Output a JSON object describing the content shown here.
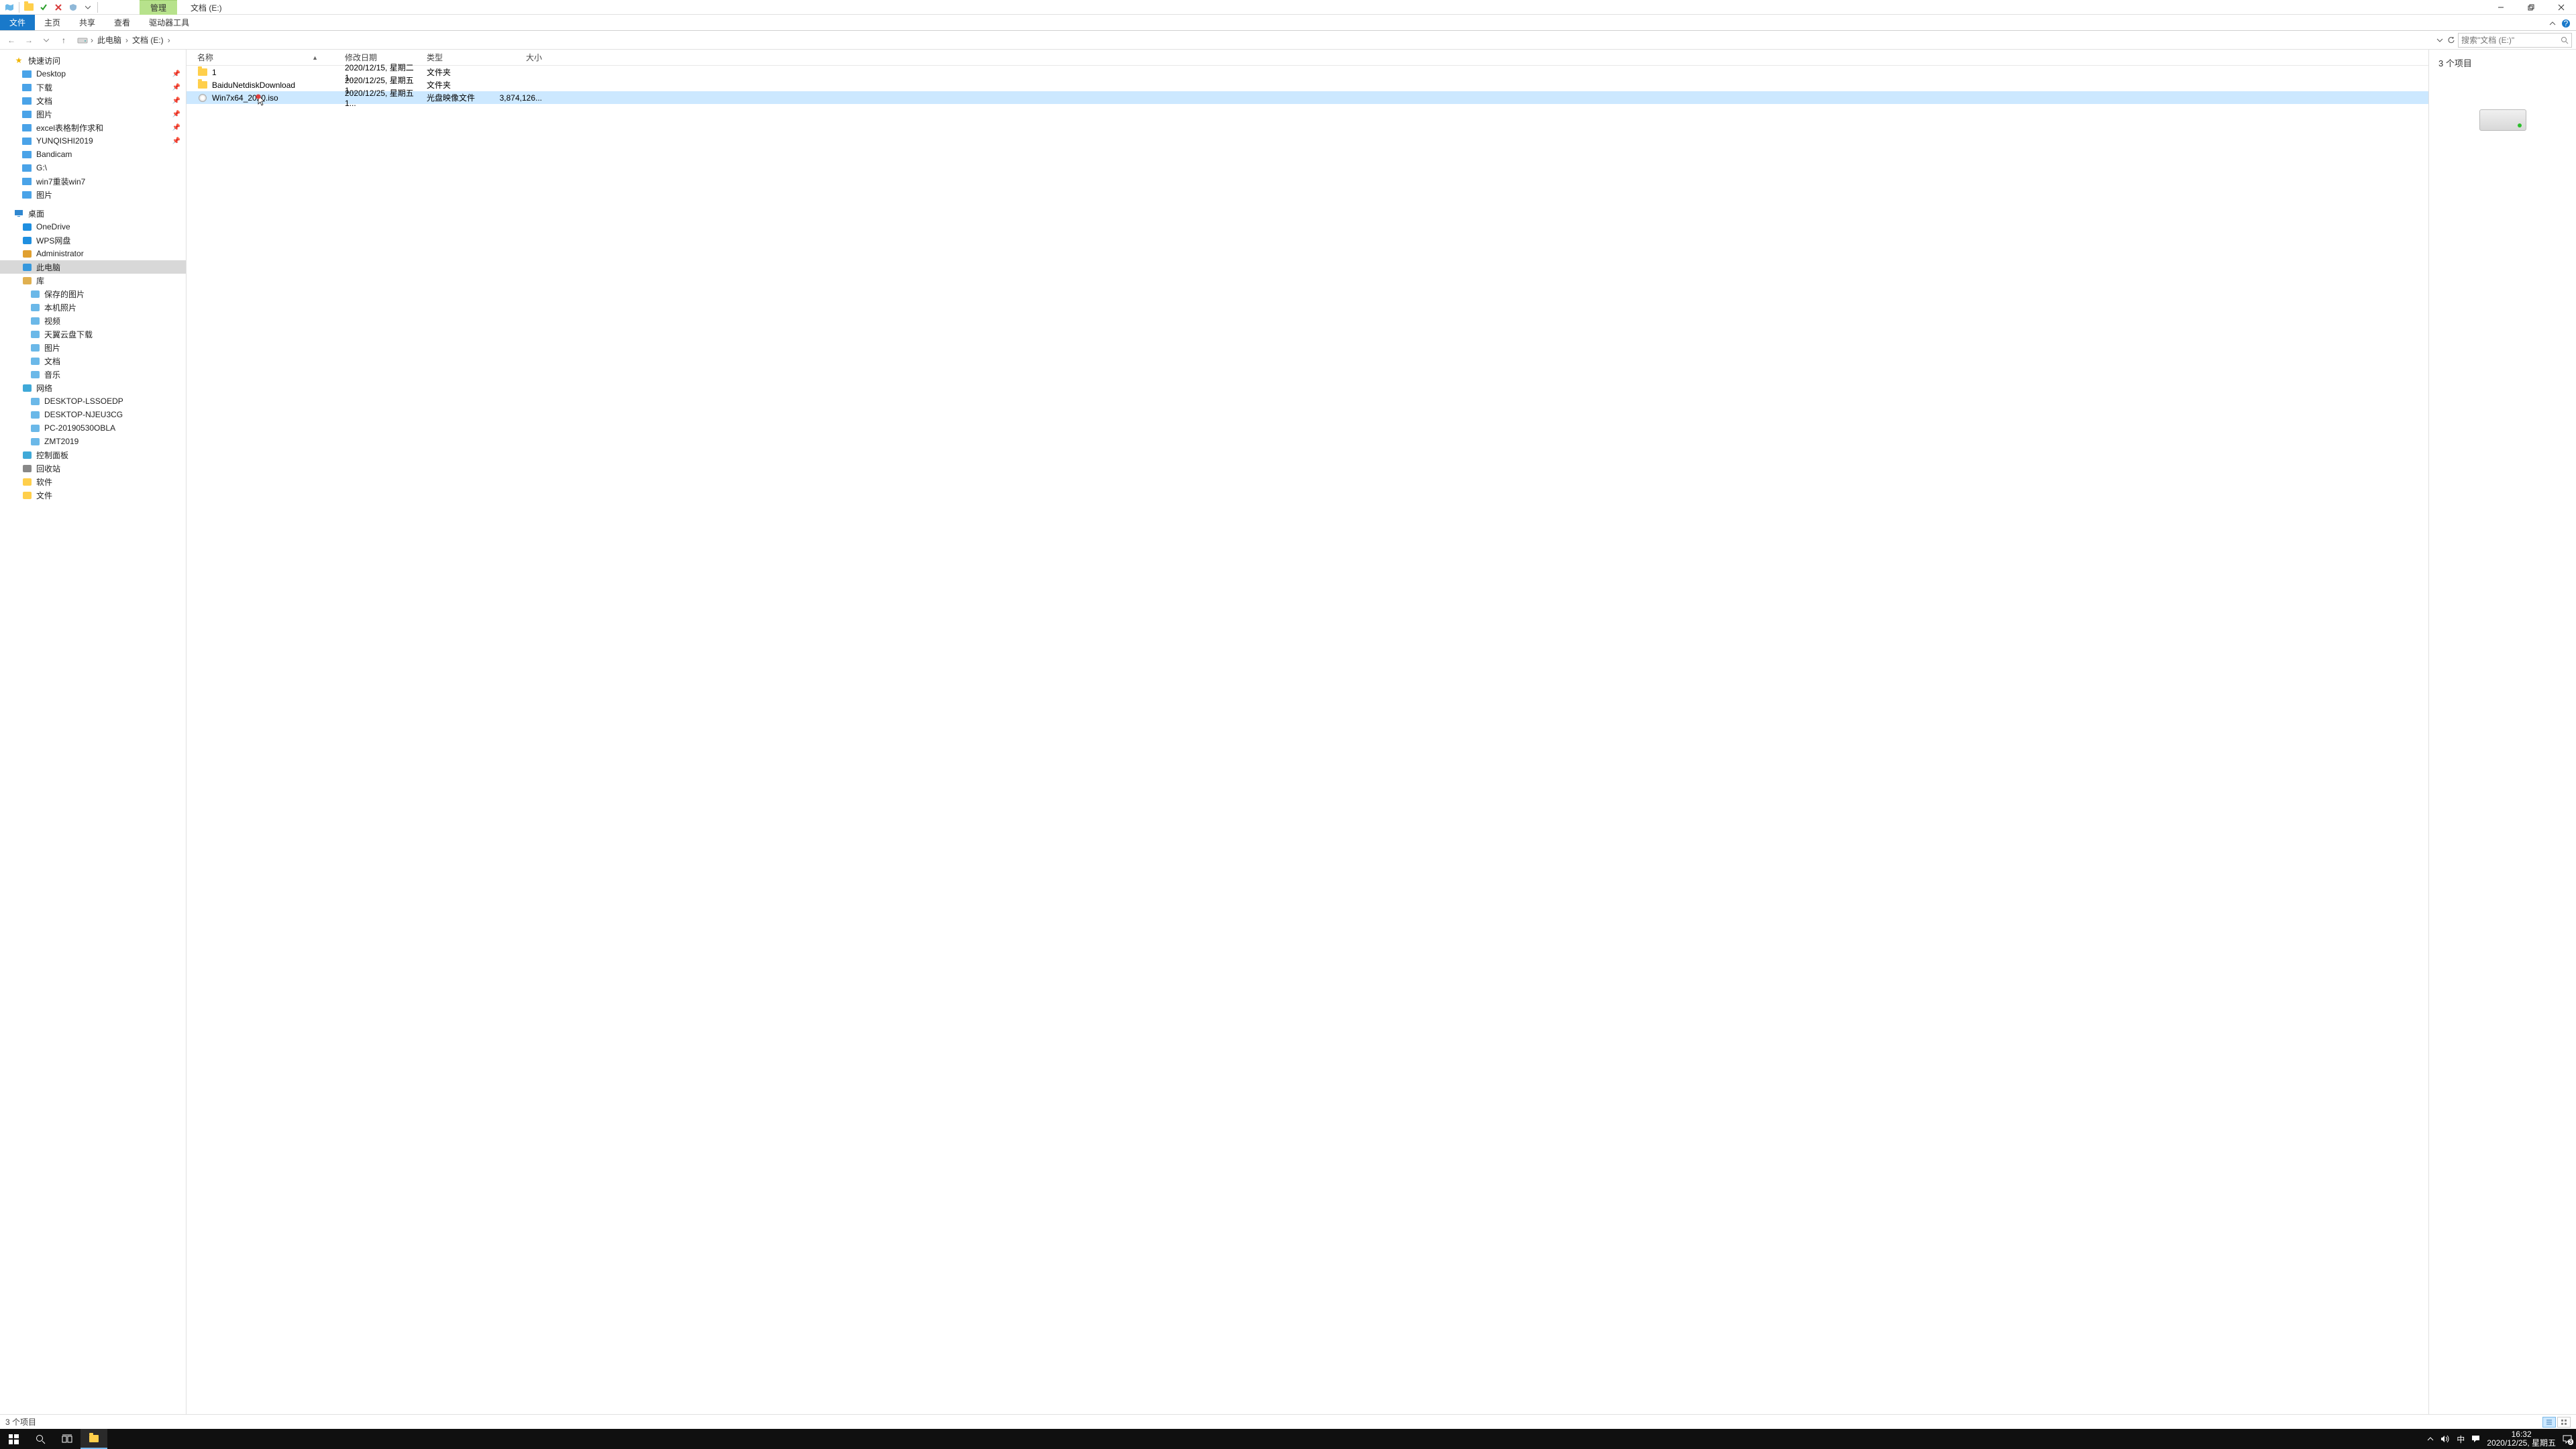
{
  "titlebar": {
    "ctx_tab": "管理",
    "location": "文档 (E:)"
  },
  "ribbon": {
    "file": "文件",
    "home": "主页",
    "share": "共享",
    "view": "查看",
    "drive_tools": "驱动器工具"
  },
  "address": {
    "crumbs": [
      "此电脑",
      "文档 (E:)"
    ],
    "search_placeholder": "搜索\"文档 (E:)\""
  },
  "tree": {
    "quick_access": "快速访问",
    "pinned": [
      {
        "label": "Desktop"
      },
      {
        "label": "下载"
      },
      {
        "label": "文档"
      },
      {
        "label": "图片"
      },
      {
        "label": "excel表格制作求和"
      },
      {
        "label": "YUNQISHI2019"
      },
      {
        "label": "Bandicam"
      },
      {
        "label": "G:\\"
      },
      {
        "label": "win7重装win7"
      },
      {
        "label": "图片"
      }
    ],
    "desktop": "桌面",
    "desk_children": [
      {
        "label": "OneDrive",
        "color": "#1f8fe0"
      },
      {
        "label": "WPS网盘",
        "color": "#1f8fe0"
      },
      {
        "label": "Administrator",
        "color": "#e0a030"
      },
      {
        "label": "此电脑",
        "color": "#3698dd",
        "selected": true
      },
      {
        "label": "库",
        "color": "#e0b050"
      },
      {
        "label": "保存的图片",
        "lvl": 2
      },
      {
        "label": "本机照片",
        "lvl": 2
      },
      {
        "label": "视频",
        "lvl": 2
      },
      {
        "label": "天翼云盘下载",
        "lvl": 2
      },
      {
        "label": "图片",
        "lvl": 2
      },
      {
        "label": "文档",
        "lvl": 2
      },
      {
        "label": "音乐",
        "lvl": 2
      },
      {
        "label": "网络",
        "color": "#3fa9d8"
      },
      {
        "label": "DESKTOP-LSSOEDP",
        "lvl": 2
      },
      {
        "label": "DESKTOP-NJEU3CG",
        "lvl": 2
      },
      {
        "label": "PC-20190530OBLA",
        "lvl": 2
      },
      {
        "label": "ZMT2019",
        "lvl": 2
      },
      {
        "label": "控制面板",
        "color": "#3fa9d8"
      },
      {
        "label": "回收站",
        "color": "#888"
      },
      {
        "label": "软件",
        "color": "#ffcf4b"
      },
      {
        "label": "文件",
        "color": "#ffcf4b"
      }
    ]
  },
  "columns": {
    "name": "名称",
    "date": "修改日期",
    "type": "类型",
    "size": "大小"
  },
  "files": [
    {
      "name": "1",
      "date": "2020/12/15, 星期二 1...",
      "type": "文件夹",
      "size": "",
      "icon": "folder"
    },
    {
      "name": "BaiduNetdiskDownload",
      "date": "2020/12/25, 星期五 1...",
      "type": "文件夹",
      "size": "",
      "icon": "folder"
    },
    {
      "name": "Win7x64_2020.iso",
      "date": "2020/12/25, 星期五 1...",
      "type": "光盘映像文件",
      "size": "3,874,126...",
      "icon": "disc",
      "selected": true
    }
  ],
  "preview": {
    "title": "3 个项目"
  },
  "status": {
    "text": "3 个项目"
  },
  "tray": {
    "ime": "中",
    "time": "16:32",
    "date": "2020/12/25, 星期五",
    "badge": "3"
  }
}
